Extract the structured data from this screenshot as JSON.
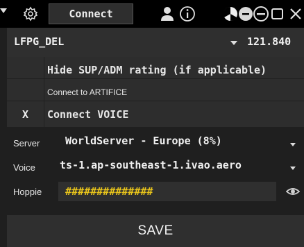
{
  "titlebar": {
    "connect_label": "Connect",
    "icons": [
      "chevron-down-icon",
      "gear-icon",
      "user-icon",
      "info-icon",
      "pie-icon",
      "minimize-icon",
      "minus-icon",
      "maximize-icon",
      "close-icon"
    ]
  },
  "station": {
    "code": "LFPG_DEL",
    "frequency": "121.840"
  },
  "options": [
    {
      "check": "",
      "label": "Hide SUP/ADM rating (if applicable)"
    },
    {
      "check": "",
      "label": "Connect to ARTIFICE"
    },
    {
      "check": "X",
      "label": "Connect VOICE"
    }
  ],
  "form": {
    "server_label": "Server",
    "server_value": "WorldServer - Europe (8%)",
    "voice_label": "Voice",
    "voice_value": "ts-1.ap-southeast-1.ivao.aero",
    "hoppie_label": "Hoppie",
    "hoppie_value": "##############"
  },
  "save_label": "SAVE",
  "colors": {
    "background": "#1f1f1f",
    "panel": "#2f2f2f",
    "titlebar": "#000000",
    "masked_text": "#e8c41b"
  }
}
